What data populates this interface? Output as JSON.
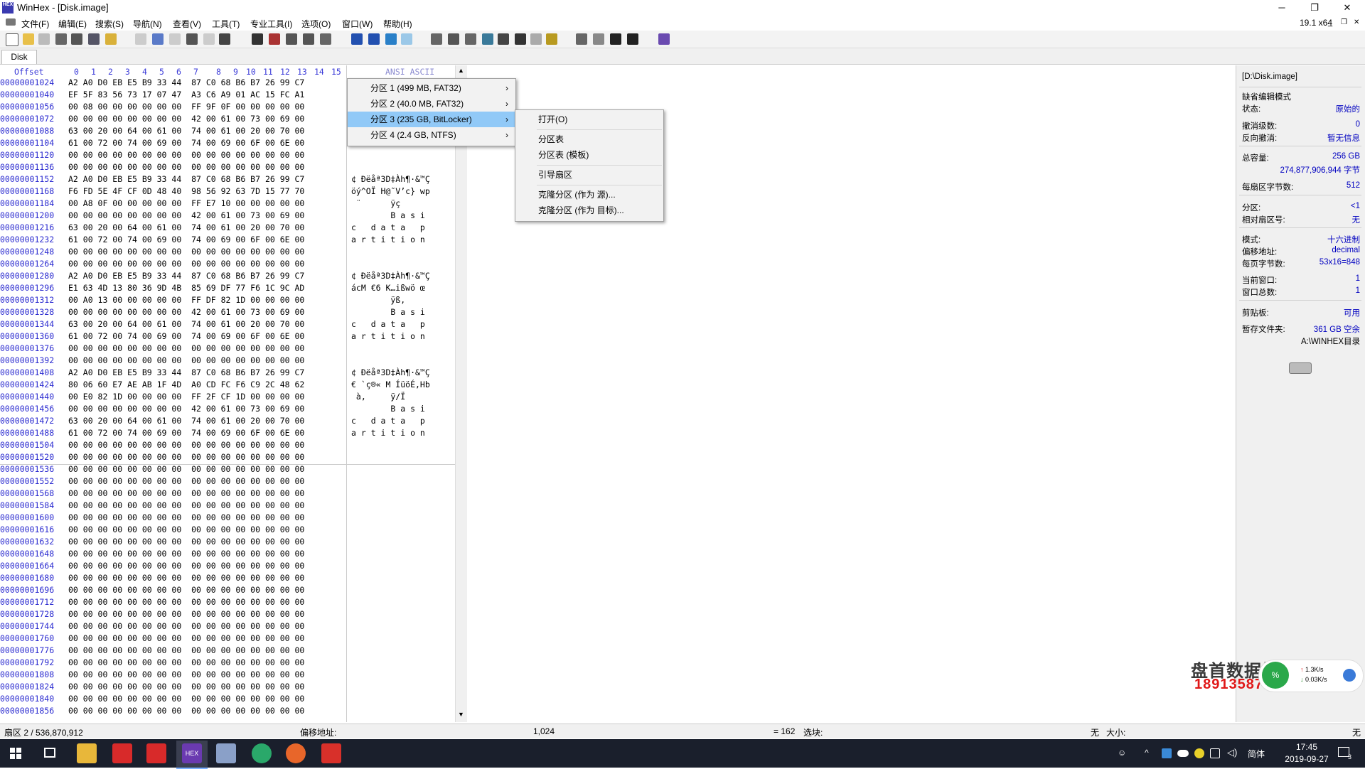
{
  "window": {
    "title": "WinHex - [Disk.image]",
    "version": "19.1 x64",
    "logo_text": "HEX"
  },
  "menu": [
    "文件(F)",
    "编辑(E)",
    "搜索(S)",
    "导航(N)",
    "查看(V)",
    "工具(T)",
    "专业工具(I)",
    "选项(O)",
    "窗口(W)",
    "帮助(H)"
  ],
  "tab": {
    "label": "Disk"
  },
  "hex_header": {
    "offset": "Offset",
    "cols": [
      "0",
      "1",
      "2",
      "3",
      "4",
      "5",
      "6",
      "7",
      "8",
      "9",
      "10",
      "11",
      "12",
      "13",
      "14",
      "15"
    ],
    "ascii": "ANSI ASCII"
  },
  "hex_rows": [
    {
      "off": "00000001024",
      "hex": "A2 A0 D0 EB E5 B9 33 44  87 C0 68 B6 B7 26 99 C7",
      "asc": ""
    },
    {
      "off": "00000001040",
      "hex": "EF 5F 83 56 73 17 07 47  A3 C6 A9 01 AC 15 FC A1",
      "asc": ""
    },
    {
      "off": "00000001056",
      "hex": "00 08 00 00 00 00 00 00  FF 9F 0F 00 00 00 00 00",
      "asc": ""
    },
    {
      "off": "00000001072",
      "hex": "00 00 00 00 00 00 00 00  42 00 61 00 73 00 69 00",
      "asc": ""
    },
    {
      "off": "00000001088",
      "hex": "63 00 20 00 64 00 61 00  74 00 61 00 20 00 70 00",
      "asc": ""
    },
    {
      "off": "00000001104",
      "hex": "61 00 72 00 74 00 69 00  74 00 69 00 6F 00 6E 00",
      "asc": ""
    },
    {
      "off": "00000001120",
      "hex": "00 00 00 00 00 00 00 00  00 00 00 00 00 00 00 00",
      "asc": ""
    },
    {
      "off": "00000001136",
      "hex": "00 00 00 00 00 00 00 00  00 00 00 00 00 00 00 00",
      "asc": ""
    },
    {
      "off": "00000001152",
      "hex": "A2 A0 D0 EB E5 B9 33 44  87 C0 68 B6 B7 26 99 C7",
      "asc": "¢ ĐëåªЗD‡Àh¶·&™Ç"
    },
    {
      "off": "00000001168",
      "hex": "F6 FD 5E 4F CF 0D 48 40  98 56 92 63 7D 15 77 70",
      "asc": "öý^OÏ H@˜V’c} wp"
    },
    {
      "off": "00000001184",
      "hex": "00 A8 0F 00 00 00 00 00  FF E7 10 00 00 00 00 00",
      "asc": " ¨      ÿç"
    },
    {
      "off": "00000001200",
      "hex": "00 00 00 00 00 00 00 00  42 00 61 00 73 00 69 00",
      "asc": "        B a s i"
    },
    {
      "off": "00000001216",
      "hex": "63 00 20 00 64 00 61 00  74 00 61 00 20 00 70 00",
      "asc": "c   d a t a   p"
    },
    {
      "off": "00000001232",
      "hex": "61 00 72 00 74 00 69 00  74 00 69 00 6F 00 6E 00",
      "asc": "a r t i t i o n"
    },
    {
      "off": "00000001248",
      "hex": "00 00 00 00 00 00 00 00  00 00 00 00 00 00 00 00",
      "asc": ""
    },
    {
      "off": "00000001264",
      "hex": "00 00 00 00 00 00 00 00  00 00 00 00 00 00 00 00",
      "asc": ""
    },
    {
      "off": "00000001280",
      "hex": "A2 A0 D0 EB E5 B9 33 44  87 C0 68 B6 B7 26 99 C7",
      "asc": "¢ ĐëåªЗD‡Àh¶·&™Ç"
    },
    {
      "off": "00000001296",
      "hex": "E1 63 4D 13 80 36 9D 4B  85 69 DF 77 F6 1C 9C AD",
      "asc": "ácM €6 K…ißwö œ­"
    },
    {
      "off": "00000001312",
      "hex": "00 A0 13 00 00 00 00 00  FF DF 82 1D 00 00 00 00",
      "asc": "        ÿß‚"
    },
    {
      "off": "00000001328",
      "hex": "00 00 00 00 00 00 00 00  42 00 61 00 73 00 69 00",
      "asc": "        B a s i"
    },
    {
      "off": "00000001344",
      "hex": "63 00 20 00 64 00 61 00  74 00 61 00 20 00 70 00",
      "asc": "c   d a t a   p"
    },
    {
      "off": "00000001360",
      "hex": "61 00 72 00 74 00 69 00  74 00 69 00 6F 00 6E 00",
      "asc": "a r t i t i o n"
    },
    {
      "off": "00000001376",
      "hex": "00 00 00 00 00 00 00 00  00 00 00 00 00 00 00 00",
      "asc": ""
    },
    {
      "off": "00000001392",
      "hex": "00 00 00 00 00 00 00 00  00 00 00 00 00 00 00 00",
      "asc": ""
    },
    {
      "off": "00000001408",
      "hex": "A2 A0 D0 EB E5 B9 33 44  87 C0 68 B6 B7 26 99 C7",
      "asc": "¢ ĐëåªЗD‡Àh¶·&™Ç"
    },
    {
      "off": "00000001424",
      "hex": "80 06 60 E7 AE AB 1F 4D  A0 CD FC F6 C9 2C 48 62",
      "asc": "€ `ç®« M ÍüöÉ,Hb"
    },
    {
      "off": "00000001440",
      "hex": "00 E0 82 1D 00 00 00 00  FF 2F CF 1D 00 00 00 00",
      "asc": " à‚     ÿ/Ï"
    },
    {
      "off": "00000001456",
      "hex": "00 00 00 00 00 00 00 00  42 00 61 00 73 00 69 00",
      "asc": "        B a s i"
    },
    {
      "off": "00000001472",
      "hex": "63 00 20 00 64 00 61 00  74 00 61 00 20 00 70 00",
      "asc": "c   d a t a   p"
    },
    {
      "off": "00000001488",
      "hex": "61 00 72 00 74 00 69 00  74 00 69 00 6F 00 6E 00",
      "asc": "a r t i t i o n"
    },
    {
      "off": "00000001504",
      "hex": "00 00 00 00 00 00 00 00  00 00 00 00 00 00 00 00",
      "asc": ""
    },
    {
      "off": "00000001520",
      "hex": "00 00 00 00 00 00 00 00  00 00 00 00 00 00 00 00",
      "asc": ""
    },
    {
      "off": "00000001536",
      "hex": "00 00 00 00 00 00 00 00  00 00 00 00 00 00 00 00",
      "asc": ""
    },
    {
      "off": "00000001552",
      "hex": "00 00 00 00 00 00 00 00  00 00 00 00 00 00 00 00",
      "asc": ""
    },
    {
      "off": "00000001568",
      "hex": "00 00 00 00 00 00 00 00  00 00 00 00 00 00 00 00",
      "asc": ""
    },
    {
      "off": "00000001584",
      "hex": "00 00 00 00 00 00 00 00  00 00 00 00 00 00 00 00",
      "asc": ""
    },
    {
      "off": "00000001600",
      "hex": "00 00 00 00 00 00 00 00  00 00 00 00 00 00 00 00",
      "asc": ""
    },
    {
      "off": "00000001616",
      "hex": "00 00 00 00 00 00 00 00  00 00 00 00 00 00 00 00",
      "asc": ""
    },
    {
      "off": "00000001632",
      "hex": "00 00 00 00 00 00 00 00  00 00 00 00 00 00 00 00",
      "asc": ""
    },
    {
      "off": "00000001648",
      "hex": "00 00 00 00 00 00 00 00  00 00 00 00 00 00 00 00",
      "asc": ""
    },
    {
      "off": "00000001664",
      "hex": "00 00 00 00 00 00 00 00  00 00 00 00 00 00 00 00",
      "asc": ""
    },
    {
      "off": "00000001680",
      "hex": "00 00 00 00 00 00 00 00  00 00 00 00 00 00 00 00",
      "asc": ""
    },
    {
      "off": "00000001696",
      "hex": "00 00 00 00 00 00 00 00  00 00 00 00 00 00 00 00",
      "asc": ""
    },
    {
      "off": "00000001712",
      "hex": "00 00 00 00 00 00 00 00  00 00 00 00 00 00 00 00",
      "asc": ""
    },
    {
      "off": "00000001728",
      "hex": "00 00 00 00 00 00 00 00  00 00 00 00 00 00 00 00",
      "asc": ""
    },
    {
      "off": "00000001744",
      "hex": "00 00 00 00 00 00 00 00  00 00 00 00 00 00 00 00",
      "asc": ""
    },
    {
      "off": "00000001760",
      "hex": "00 00 00 00 00 00 00 00  00 00 00 00 00 00 00 00",
      "asc": ""
    },
    {
      "off": "00000001776",
      "hex": "00 00 00 00 00 00 00 00  00 00 00 00 00 00 00 00",
      "asc": ""
    },
    {
      "off": "00000001792",
      "hex": "00 00 00 00 00 00 00 00  00 00 00 00 00 00 00 00",
      "asc": ""
    },
    {
      "off": "00000001808",
      "hex": "00 00 00 00 00 00 00 00  00 00 00 00 00 00 00 00",
      "asc": ""
    },
    {
      "off": "00000001824",
      "hex": "00 00 00 00 00 00 00 00  00 00 00 00 00 00 00 00",
      "asc": ""
    },
    {
      "off": "00000001840",
      "hex": "00 00 00 00 00 00 00 00  00 00 00 00 00 00 00 00",
      "asc": ""
    },
    {
      "off": "00000001856",
      "hex": "00 00 00 00 00 00 00 00  00 00 00 00 00 00 00 00",
      "asc": ""
    }
  ],
  "partition_menu": [
    {
      "label": "分区 1 (499 MB, FAT32)"
    },
    {
      "label": "分区 2 (40.0 MB, FAT32)"
    },
    {
      "label": "分区 3 (235 GB, BitLocker)"
    },
    {
      "label": "分区 4 (2.4 GB, NTFS)"
    }
  ],
  "sub_menu": {
    "open": "打开(O)",
    "ptable": "分区表",
    "ptable_tpl": "分区表 (模板)",
    "boot": "引导扇区",
    "clone_src": "克隆分区 (作为 源)...",
    "clone_dst": "克隆分区 (作为 目标)..."
  },
  "info": {
    "path": "[D:\\Disk.image]",
    "edit_mode_label": "缺省编辑模式",
    "state_k": "状态:",
    "state_v": "原始的",
    "undo_k": "撤消级数:",
    "undo_v": "0",
    "revert_k": "反向撤消:",
    "revert_v": "暂无信息",
    "cap_k": "总容量:",
    "cap_v": "256 GB",
    "bytes_v": "274,877,906,944 字节",
    "sector_k": "每扇区字节数:",
    "sector_v": "512",
    "part_k": "分区:",
    "part_v": "<1",
    "relsec_k": "相对扇区号:",
    "relsec_v": "无",
    "mode_k": "模式:",
    "mode_v": "十六进制",
    "addr_k": "偏移地址:",
    "addr_v": "decimal",
    "page_k": "每页字节数:",
    "page_v": "53x16=848",
    "curwin_k": "当前窗口:",
    "curwin_v": "1",
    "totwin_k": "窗口总数:",
    "totwin_v": "1",
    "clip_k": "剪贴板:",
    "clip_v": "可用",
    "temp_k": "暂存文件夹:",
    "temp_v": "361 GB 空余",
    "temp_dir": "A:\\WINHEX目录"
  },
  "status": {
    "sector": "扇区 2 / 536,870,912",
    "offset_label": "偏移地址:",
    "offset_val": "1,024",
    "eq": "= 162",
    "sel_label": "选块:",
    "none1": "无",
    "size_label": "大小:",
    "none2": "无"
  },
  "watermark": {
    "name": "盘首数据恢复",
    "phone": "18913587620"
  },
  "net": {
    "up": "1.3K/s",
    "down": "0.03K/s",
    "pct": "%"
  },
  "taskbar": {
    "time": "17:45",
    "date": "2019-09-27",
    "ime": "简体",
    "notif": "3"
  }
}
